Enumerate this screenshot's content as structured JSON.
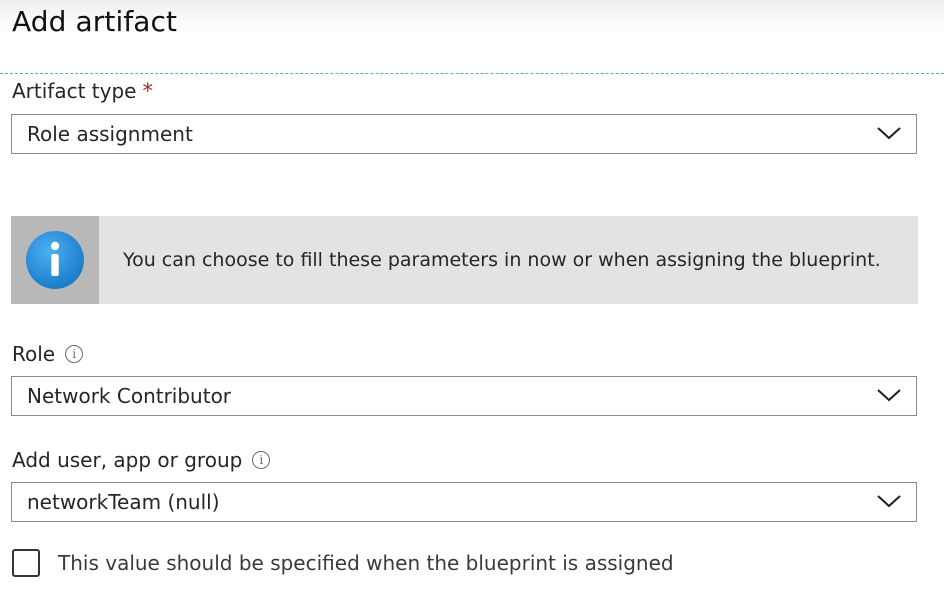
{
  "panel": {
    "title": "Add artifact"
  },
  "artifact_type": {
    "label": "Artifact type",
    "required_marker": "*",
    "value": "Role assignment"
  },
  "info_banner": {
    "icon": "info-icon",
    "text": "You can choose to fill these parameters in now or when assigning the blueprint."
  },
  "role": {
    "label": "Role",
    "info_icon_glyph": "i",
    "value": "Network Contributor"
  },
  "principal": {
    "label": "Add user, app or group",
    "info_icon_glyph": "i",
    "value": "networkTeam (null)"
  },
  "assign_later": {
    "checked": false,
    "label": "This value should be specified when the blueprint is assigned"
  },
  "colors": {
    "required": "#a4262c",
    "info_blue": "#1f8fe0",
    "banner_bg": "#e3e3e3",
    "divider": "#5aa7d6"
  }
}
